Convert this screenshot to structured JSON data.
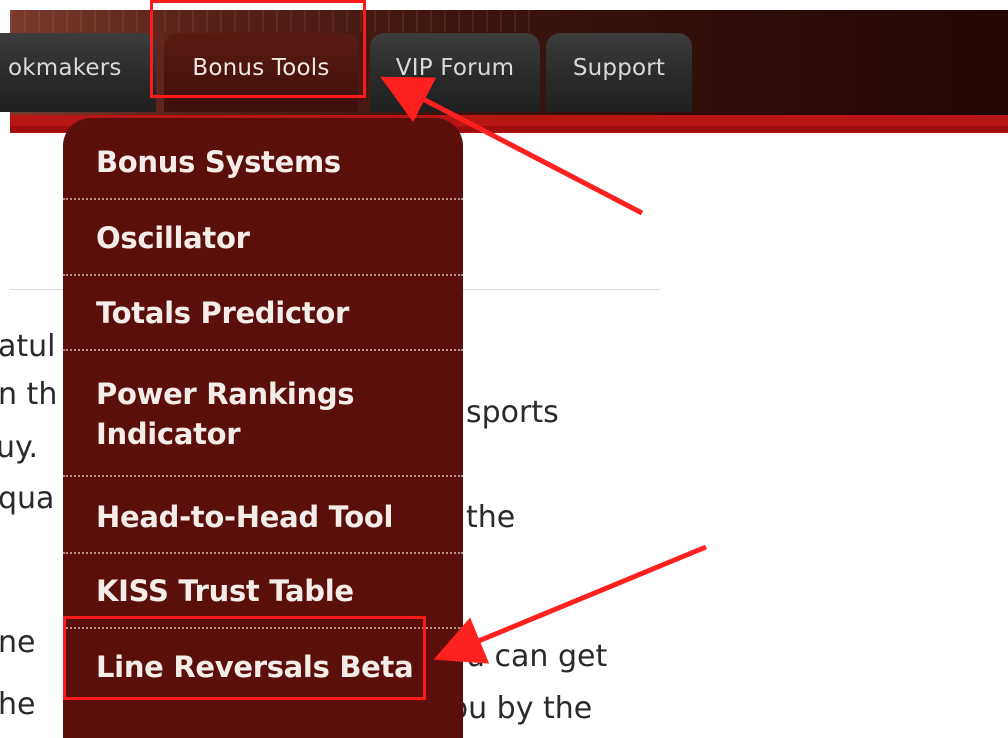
{
  "nav": {
    "tabs": [
      {
        "label": "okmakers"
      },
      {
        "label": "Bonus Tools"
      },
      {
        "label": "VIP Forum"
      },
      {
        "label": "Support"
      }
    ]
  },
  "menu": {
    "items": [
      {
        "label": "Bonus Systems"
      },
      {
        "label": "Oscillator"
      },
      {
        "label": "Totals Predictor"
      },
      {
        "label_line1": "Power Rankings",
        "label_line2": "Indicator"
      },
      {
        "label": "Head-to-Head Tool"
      },
      {
        "label": "KISS Trust Table"
      },
      {
        "label": "Line Reversals Beta"
      }
    ]
  },
  "content": {
    "lines_left": [
      "atul",
      "n th",
      "uy.",
      "qua",
      "'",
      "ne",
      "he"
    ],
    "lines_right": [
      "sports",
      "the",
      "u can get",
      "you by the"
    ]
  },
  "annotations": {
    "highlight_color": "#ff1a1a",
    "arrow_color": "#ff2020"
  }
}
